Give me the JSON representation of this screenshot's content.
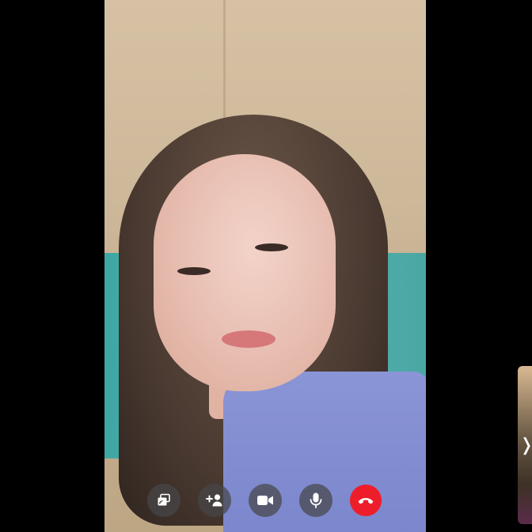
{
  "call": {
    "controls": [
      {
        "id": "share-screen",
        "icon": "screen-share-icon"
      },
      {
        "id": "add-person",
        "icon": "add-person-icon"
      },
      {
        "id": "video",
        "icon": "video-camera-icon"
      },
      {
        "id": "mute",
        "icon": "microphone-icon"
      },
      {
        "id": "end-call",
        "icon": "end-call-icon",
        "color": "#ee1d2a"
      }
    ],
    "preview": {
      "icon": "chevron-right-icon",
      "glyph": "❭"
    }
  },
  "colors": {
    "background": "#000000",
    "control_bg": "#464648",
    "end_call": "#ee1d2a",
    "icon": "#ffffff"
  }
}
